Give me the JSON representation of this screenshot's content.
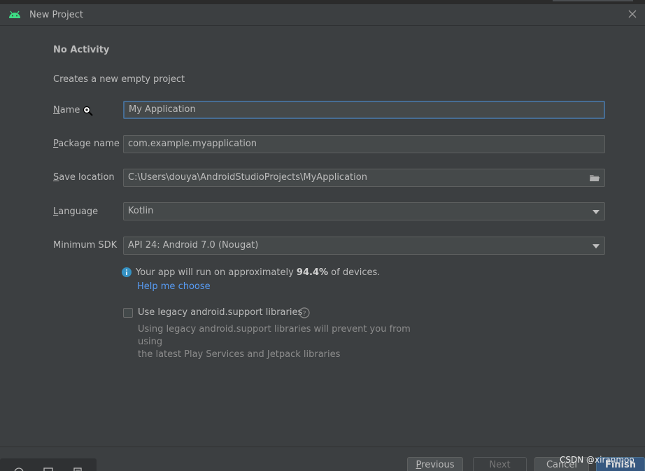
{
  "window": {
    "title": "New Project",
    "icon": "android-icon"
  },
  "header": {
    "heading": "No Activity",
    "subtitle": "Creates a new empty project"
  },
  "form": {
    "name": {
      "label": "Name",
      "mnemonic": "N",
      "rest": "ame",
      "value": "My Application"
    },
    "package": {
      "label": "Package name",
      "mnemonic": "P",
      "rest": "ackage name",
      "value": "com.example.myapplication"
    },
    "location": {
      "label": "Save location",
      "mnemonic": "S",
      "rest": "ave location",
      "value": "C:\\Users\\douya\\AndroidStudioProjects\\MyApplication"
    },
    "language": {
      "label": "Language",
      "mnemonic": "L",
      "rest": "anguage",
      "value": "Kotlin"
    },
    "min_sdk": {
      "label": "Minimum SDK",
      "value": "API 24: Android 7.0 (Nougat)"
    }
  },
  "info": {
    "text_before": "Your app will run on approximately ",
    "percent": "94.4%",
    "text_after": " of devices.",
    "help_link": "Help me choose"
  },
  "legacy": {
    "checkbox_label": "Use legacy android.support libraries",
    "checked": false,
    "note_line1": "Using legacy android.support libraries will prevent you from using",
    "note_line2": "the latest Play Services and Jetpack libraries"
  },
  "footer": {
    "previous": "Previous",
    "previous_mnemonic": "P",
    "previous_rest": "revious",
    "next": "Next",
    "cancel": "Cancel",
    "finish": "Finish"
  },
  "watermark": "CSDN @xiranmoo",
  "colors": {
    "background": "#3c3f41",
    "field": "#45494a",
    "focus_border": "#466d94",
    "link": "#589df6",
    "info": "#3592c4",
    "android_green": "#3ddc84"
  }
}
